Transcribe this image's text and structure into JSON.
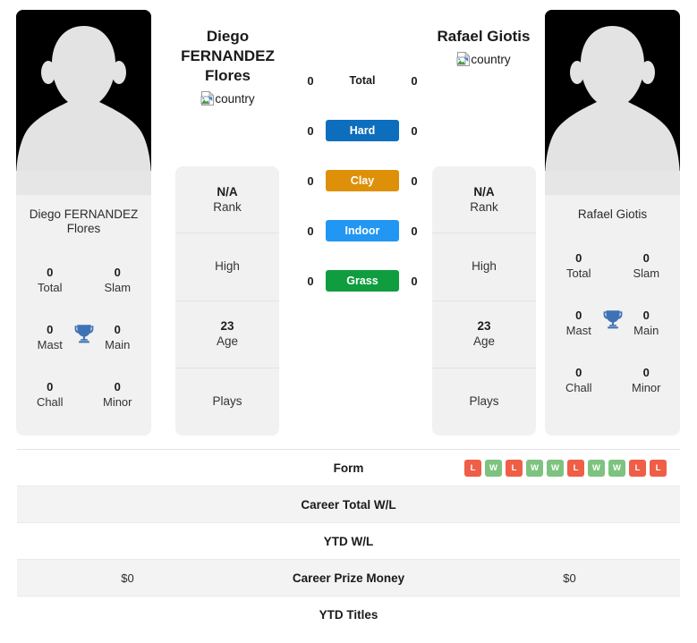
{
  "colors": {
    "hard": "#0d6ebd",
    "clay": "#dd9008",
    "indoor": "#2196f3",
    "grass": "#0f9d3f",
    "win": "#7dc37f",
    "loss": "#ef5e46",
    "card_bg": "#f1f1f1",
    "row_alt_bg": "#f3f3f3",
    "photo_bg": "#000000"
  },
  "players": {
    "left": {
      "title": "Diego\nFERNANDEZ\nFlores",
      "title_line1": "Diego",
      "title_line2": "FERNANDEZ",
      "title_line3": "Flores",
      "flag_alt": "country",
      "flag_icon": "broken-image-icon",
      "photo_name_line1": "Diego FERNANDEZ",
      "photo_name_line2": "Flores",
      "avatar_icon": "player-avatar-silhouette",
      "titles": {
        "total_value": "0",
        "total_label": "Total",
        "slam_value": "0",
        "slam_label": "Slam",
        "mast_value": "0",
        "mast_label": "Mast",
        "main_value": "0",
        "main_label": "Main",
        "chall_value": "0",
        "chall_label": "Chall",
        "minor_value": "0",
        "minor_label": "Minor",
        "trophy_icon": "trophy-icon"
      },
      "info": [
        {
          "value": "N/A",
          "label": "Rank"
        },
        {
          "value": "",
          "label": "High"
        },
        {
          "value": "23",
          "label": "Age"
        },
        {
          "value": "",
          "label": "Plays"
        }
      ]
    },
    "right": {
      "title_line1": "Rafael Giotis",
      "title_line2": "",
      "title_line3": "",
      "flag_alt": "country",
      "flag_icon": "broken-image-icon",
      "photo_name_line1": "Rafael Giotis",
      "photo_name_line2": "",
      "avatar_icon": "player-avatar-silhouette",
      "titles": {
        "total_value": "0",
        "total_label": "Total",
        "slam_value": "0",
        "slam_label": "Slam",
        "mast_value": "0",
        "mast_label": "Mast",
        "main_value": "0",
        "main_label": "Main",
        "chall_value": "0",
        "chall_label": "Chall",
        "minor_value": "0",
        "minor_label": "Minor",
        "trophy_icon": "trophy-icon"
      },
      "info": [
        {
          "value": "N/A",
          "label": "Rank"
        },
        {
          "value": "",
          "label": "High"
        },
        {
          "value": "23",
          "label": "Age"
        },
        {
          "value": "",
          "label": "Plays"
        }
      ]
    }
  },
  "surfaces": [
    {
      "label": "Total",
      "left": "0",
      "right": "0",
      "badge": false,
      "color": ""
    },
    {
      "label": "Hard",
      "left": "0",
      "right": "0",
      "badge": true,
      "color": "#0d6ebd"
    },
    {
      "label": "Clay",
      "left": "0",
      "right": "0",
      "badge": true,
      "color": "#dd9008"
    },
    {
      "label": "Indoor",
      "left": "0",
      "right": "0",
      "badge": true,
      "color": "#2196f3"
    },
    {
      "label": "Grass",
      "left": "0",
      "right": "0",
      "badge": true,
      "color": "#0f9d3f"
    }
  ],
  "stats_table": {
    "rows": [
      {
        "label": "Form",
        "left": "",
        "right": "",
        "alt": false,
        "form": [
          "L",
          "W",
          "L",
          "W",
          "W",
          "L",
          "W",
          "W",
          "L",
          "L"
        ]
      },
      {
        "label": "Career Total W/L",
        "left": "",
        "right": "",
        "alt": true,
        "form": null
      },
      {
        "label": "YTD W/L",
        "left": "",
        "right": "",
        "alt": false,
        "form": null
      },
      {
        "label": "Career Prize Money",
        "left": "$0",
        "right": "$0",
        "alt": true,
        "form": null
      },
      {
        "label": "YTD Titles",
        "left": "",
        "right": "",
        "alt": false,
        "form": null
      }
    ]
  }
}
